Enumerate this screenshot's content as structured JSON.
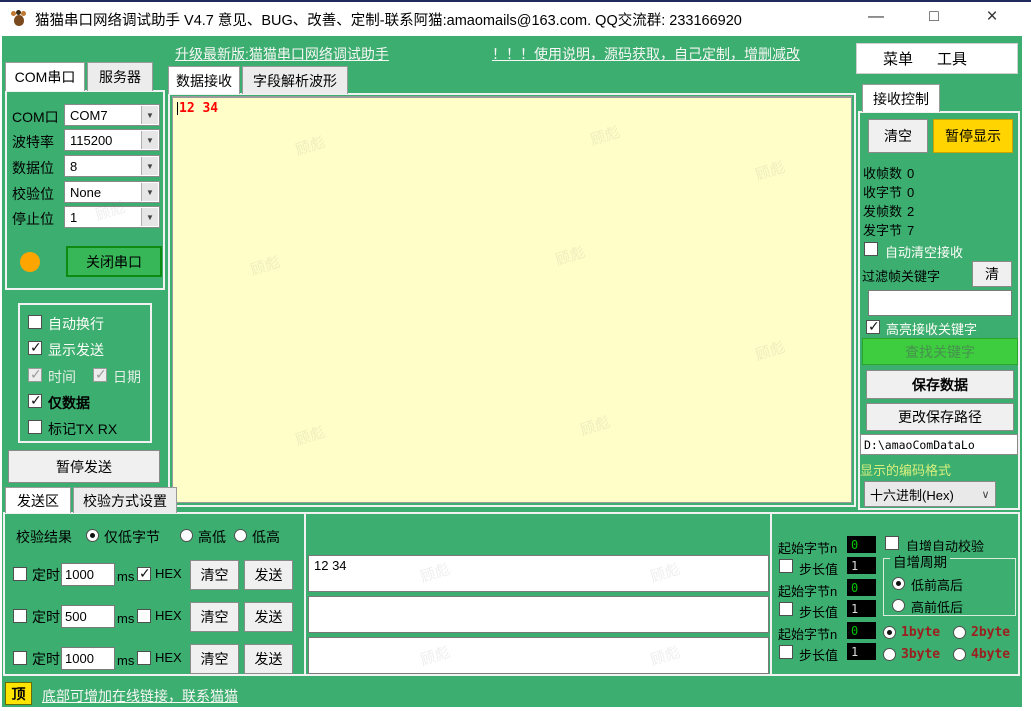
{
  "watermark": "顾彪",
  "window": {
    "title": "猫猫串口网络调试助手 V4.7 意见、BUG、改善、定制-联系阿猫:amaomails@163.com. QQ交流群: 233166920",
    "minimize": "—",
    "maximize": "□",
    "close": "×"
  },
  "header": {
    "upgrade_link": "升级最新版:猫猫串口网络调试助手",
    "usage_link": "！！！使用说明，源码获取，自己定制，增删减改",
    "menu": "菜单",
    "tools": "工具"
  },
  "com_panel": {
    "tabs": [
      {
        "label": "COM串口",
        "active": true
      },
      {
        "label": "服务器",
        "active": false
      }
    ],
    "fields": [
      {
        "label": "COM口",
        "value": "COM7"
      },
      {
        "label": "波特率",
        "value": "115200"
      },
      {
        "label": "数据位",
        "value": "8"
      },
      {
        "label": "校验位",
        "value": "None"
      },
      {
        "label": "停止位",
        "value": "1"
      }
    ],
    "close_button": "关闭串口"
  },
  "display_options": {
    "items": [
      {
        "label": "自动换行",
        "checked": false
      },
      {
        "label": "显示发送",
        "checked": true
      },
      {
        "label": "时间",
        "checked": true,
        "disabled": true
      },
      {
        "label": "日期",
        "checked": true,
        "disabled": true
      },
      {
        "label": "仅数据",
        "checked": true
      },
      {
        "label": "标记TX RX",
        "checked": false
      }
    ],
    "pause_send_button": "暂停发送"
  },
  "send_tabs": [
    {
      "label": "发送区",
      "active": true
    },
    {
      "label": "校验方式设置",
      "active": false
    }
  ],
  "receive": {
    "tabs": [
      {
        "label": "数据接收",
        "active": true
      },
      {
        "label": "字段解析波形",
        "active": false
      }
    ],
    "content": "12 34"
  },
  "receive_control": {
    "tab": "接收控制",
    "clear_button": "清空",
    "pause_button": "暂停显示",
    "stats": [
      {
        "label": "收帧数",
        "value": "0"
      },
      {
        "label": "收字节",
        "value": "0"
      },
      {
        "label": "发帧数",
        "value": "2"
      },
      {
        "label": "发字节",
        "value": "7"
      }
    ],
    "auto_clear": {
      "label": "自动清空接收",
      "checked": false
    },
    "filter_label": "过滤帧关键字",
    "filter_clear_button": "清",
    "filter_value": "",
    "highlight": {
      "label": "高亮接收关键字",
      "checked": true
    },
    "find_button": "查找关键字",
    "save_button": "保存数据",
    "change_path_button": "更改保存路径",
    "save_path": "D:\\amaoComDataLo",
    "encoding_label": "显示的编码格式",
    "encoding_value": "十六进制(Hex)"
  },
  "send_area": {
    "checksum_label": "校验结果",
    "checksum_options": [
      {
        "label": "仅低字节",
        "selected": true
      },
      {
        "label": "高低",
        "selected": false
      },
      {
        "label": "低高",
        "selected": false
      }
    ],
    "rows": [
      {
        "timer_label": "定时",
        "timer_value": "1000",
        "ms_label": "ms",
        "hex_label": "HEX",
        "timer_checked": false,
        "hex_checked": true,
        "clear_button": "清空",
        "send_button": "发送",
        "text": "12 34"
      },
      {
        "timer_label": "定时",
        "timer_value": "500",
        "ms_label": "ms",
        "hex_label": "HEX",
        "timer_checked": false,
        "hex_checked": false,
        "clear_button": "清空",
        "send_button": "发送",
        "text": ""
      },
      {
        "timer_label": "定时",
        "timer_value": "1000",
        "ms_label": "ms",
        "hex_label": "HEX",
        "timer_checked": false,
        "hex_checked": false,
        "clear_button": "清空",
        "send_button": "发送",
        "text": ""
      }
    ]
  },
  "auto_increment": {
    "rows": [
      {
        "start_label": "起始字节n",
        "start_value": "0",
        "step_label": "步长值",
        "step_value": "1",
        "step_checked": false
      },
      {
        "start_label": "起始字节n",
        "start_value": "0",
        "step_label": "步长值",
        "step_value": "1",
        "step_checked": false
      },
      {
        "start_label": "起始字节n",
        "start_value": "0",
        "step_label": "步长值",
        "step_value": "1",
        "step_checked": false
      }
    ],
    "auto_checksum_label": "自增自动校验",
    "cycle_label": "自增周期",
    "cycle_options": [
      {
        "label": "低前高后",
        "selected": true
      },
      {
        "label": "高前低后",
        "selected": false
      }
    ],
    "byte_options": [
      {
        "label": "1byte",
        "selected": true
      },
      {
        "label": "2byte",
        "selected": false
      },
      {
        "label": "3byte",
        "selected": false
      },
      {
        "label": "4byte",
        "selected": false
      }
    ]
  },
  "footer": {
    "top_button": "顶",
    "link": "底部可增加在线链接，联系猫猫"
  },
  "colors": {
    "main_green": "#3CAE70",
    "receive_bg": "#FFFEC8",
    "pause_yellow": "#FFD400",
    "find_green": "#3ECD3E",
    "status_orange": "#FFA500",
    "receive_text_red": "#FF0000",
    "value_green": "#00C400"
  }
}
